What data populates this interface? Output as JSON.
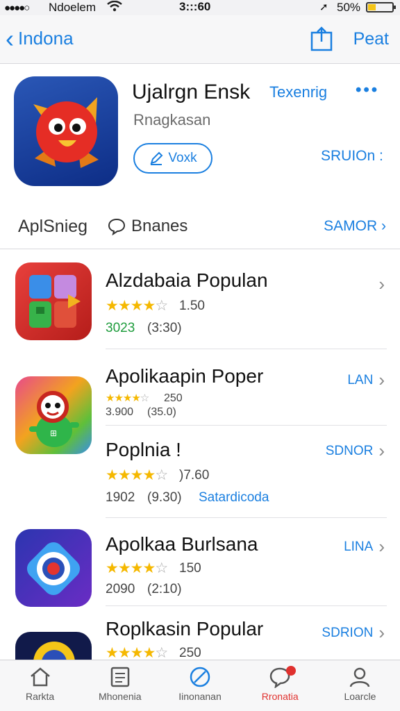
{
  "status_bar": {
    "carrier": "Ndoelem",
    "time": "3:::60",
    "battery": "50%",
    "battery_level": 0.33
  },
  "nav": {
    "back_label": "Indona",
    "right_label": "Peat"
  },
  "hero": {
    "title": "Ujalrgn Ensk",
    "tag": "Texenrig",
    "subtitle": "Rnagkasan",
    "button_label": "Voxk",
    "link_label": "SRUIOn :"
  },
  "section": {
    "title": "AplSnieg",
    "chat_label": "Bnanes",
    "link_label": "SAMOR"
  },
  "apps": [
    {
      "name": "Alzdabaia Populan",
      "rating": "1.50",
      "stars_filled": 4,
      "meta_count": "3023",
      "meta_paren": "(3:30)",
      "action": ""
    },
    {
      "name": "Apolikaapin Poper",
      "rating": "250",
      "stars_filled": 4,
      "meta_count": "3.900",
      "meta_paren": "(35.0)",
      "action": "LAN"
    },
    {
      "name": "Poplnia !",
      "rating": ")7.60",
      "stars_filled": 4,
      "meta_count": "1902",
      "meta_paren": "(9.30)",
      "meta_link": "Satardicoda",
      "action": "SDNOR"
    },
    {
      "name": "Apolkaa Burlsana",
      "rating": "150",
      "stars_filled": 4,
      "meta_count": "2090",
      "meta_paren": "(2:10)",
      "action": "LINA"
    },
    {
      "name": "Roplkasin Popular",
      "rating": "250",
      "stars_filled": 4,
      "action": "SDRION"
    }
  ],
  "tabs": [
    {
      "label": "Rarkta",
      "icon": "home-icon"
    },
    {
      "label": "Mhonenia",
      "icon": "document-icon"
    },
    {
      "label": "Iinonanan",
      "icon": "compass-icon"
    },
    {
      "label": "Rronatia",
      "icon": "chat-icon"
    },
    {
      "label": "Loarcle",
      "icon": "person-icon"
    }
  ],
  "colors": {
    "accent": "#1a7fe0",
    "star": "#f5b800",
    "badge": "#e0312e",
    "green": "#1e9c3c"
  }
}
